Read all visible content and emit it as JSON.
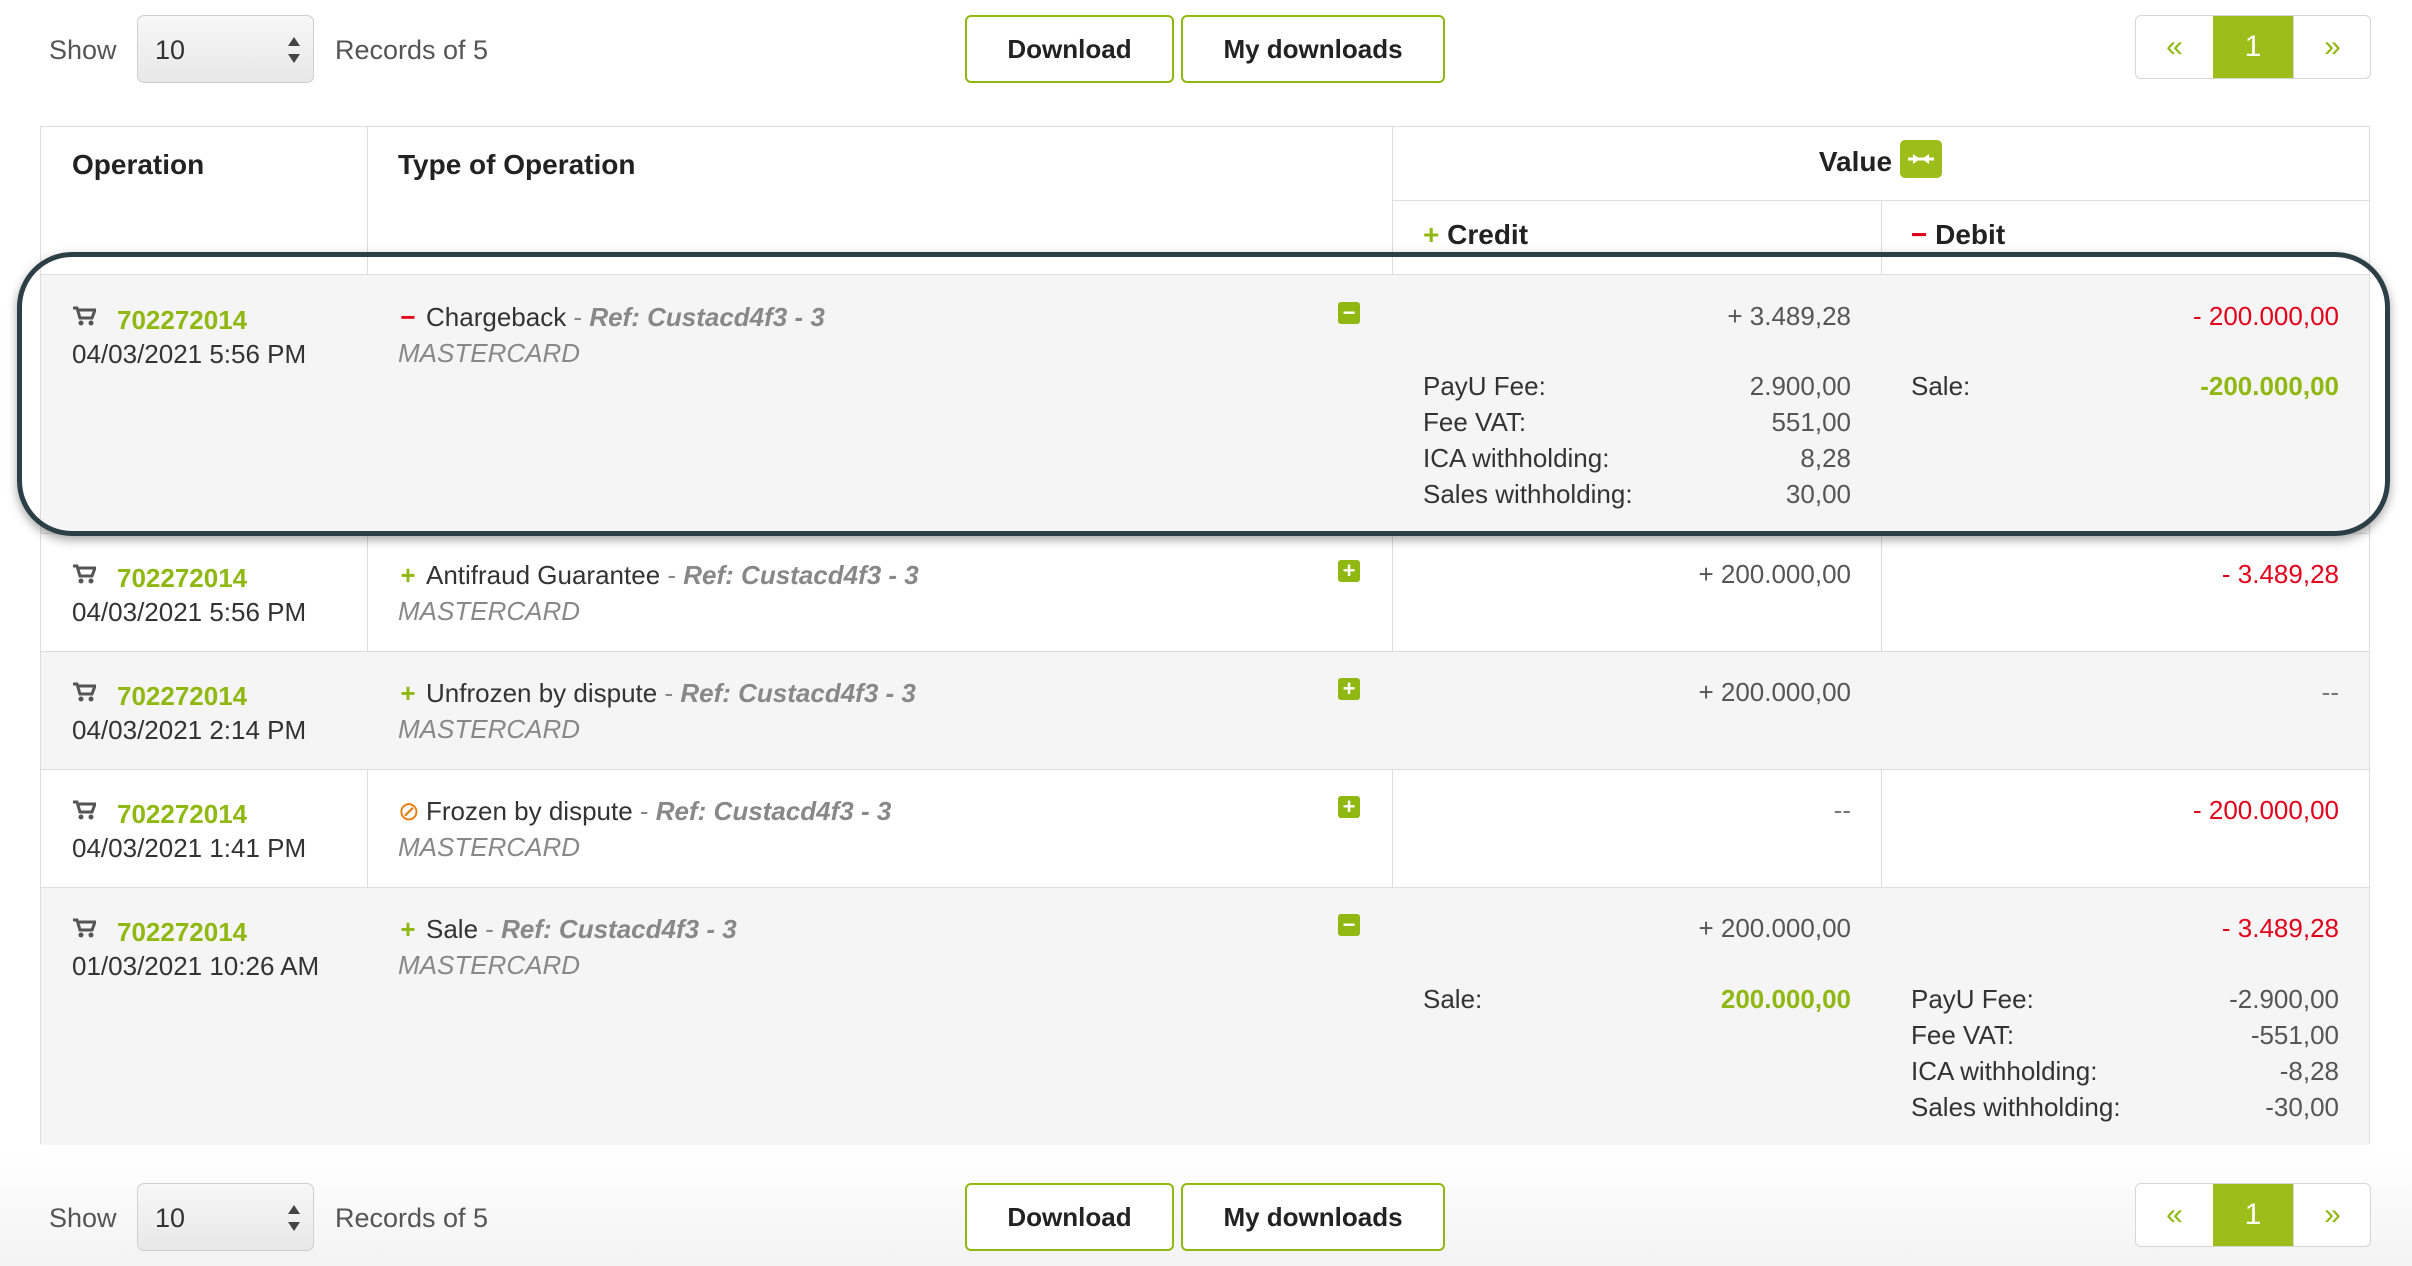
{
  "toolbar": {
    "show_label": "Show",
    "page_size": "10",
    "records_label": "Records of 5",
    "download_label": "Download",
    "my_downloads_label": "My downloads"
  },
  "pagination": {
    "prev": "«",
    "current": "1",
    "next": "»"
  },
  "table": {
    "headers": {
      "operation": "Operation",
      "type": "Type of Operation",
      "value": "Value",
      "credit": "Credit",
      "debit": "Debit"
    },
    "rows": [
      {
        "id": "702272014",
        "date": "04/03/2021 5:56 PM",
        "type_icon": "minus-icon",
        "type": "Chargeback",
        "ref": "Ref: Custacd4f3 - 3",
        "brand": "MASTERCARD",
        "toggle": "−",
        "credit": "+ 3.489,28",
        "debit": "- 200.000,00",
        "credit_details": [
          {
            "label": "PayU Fee:",
            "value": "2.900,00"
          },
          {
            "label": "Fee VAT:",
            "value": "551,00"
          },
          {
            "label": "ICA withholding:",
            "value": "8,28"
          },
          {
            "label": "Sales withholding:",
            "value": "30,00"
          }
        ],
        "debit_details": [
          {
            "label": "Sale:",
            "value": "-200.000,00"
          }
        ]
      },
      {
        "id": "702272014",
        "date": "04/03/2021 5:56 PM",
        "type_icon": "plus-icon",
        "type": "Antifraud Guarantee",
        "ref": "Ref: Custacd4f3 - 3",
        "brand": "MASTERCARD",
        "toggle": "+",
        "credit": "+ 200.000,00",
        "debit": "- 3.489,28"
      },
      {
        "id": "702272014",
        "date": "04/03/2021 2:14 PM",
        "type_icon": "plus-icon",
        "type": "Unfrozen by dispute",
        "ref": "Ref: Custacd4f3 - 3",
        "brand": "MASTERCARD",
        "toggle": "+",
        "credit": "+ 200.000,00",
        "debit": "--"
      },
      {
        "id": "702272014",
        "date": "04/03/2021 1:41 PM",
        "type_icon": "ban-icon",
        "type": "Frozen by dispute",
        "ref": "Ref: Custacd4f3 - 3",
        "brand": "MASTERCARD",
        "toggle": "+",
        "credit": "--",
        "debit": "- 200.000,00"
      },
      {
        "id": "702272014",
        "date": "01/03/2021 10:26 AM",
        "type_icon": "plus-icon",
        "type": "Sale",
        "ref": "Ref: Custacd4f3 - 3",
        "brand": "MASTERCARD",
        "toggle": "−",
        "credit": "+ 200.000,00",
        "debit": "- 3.489,28",
        "credit_details": [
          {
            "label": "Sale:",
            "value": "200.000,00"
          }
        ],
        "debit_details": [
          {
            "label": "PayU Fee:",
            "value": "-2.900,00"
          },
          {
            "label": "Fee VAT:",
            "value": "-551,00"
          },
          {
            "label": "ICA withholding:",
            "value": "-8,28"
          },
          {
            "label": "Sales withholding:",
            "value": "-30,00"
          }
        ]
      }
    ]
  },
  "colors": {
    "accent": "#8fb812",
    "negative": "#e2001a",
    "frozen": "#e87d0d",
    "highlight_border": "#2c3e46"
  }
}
